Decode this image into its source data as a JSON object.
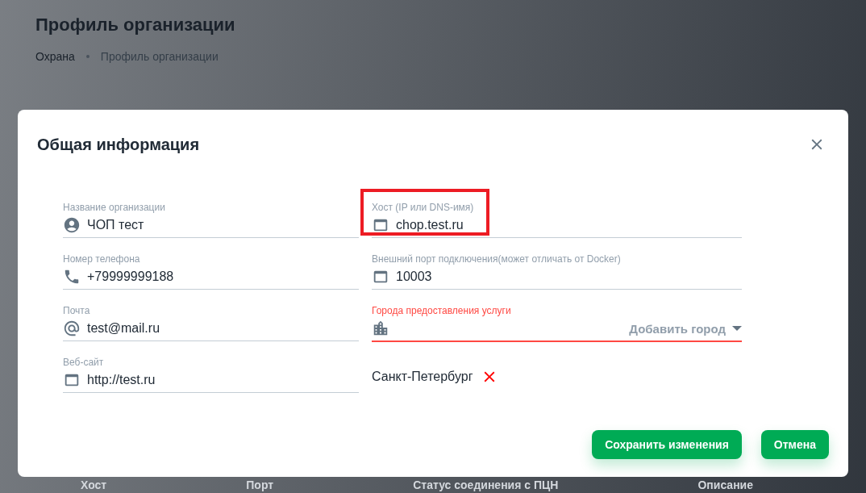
{
  "page": {
    "title": "Профиль организации",
    "breadcrumbs": [
      {
        "label": "Охрана",
        "current": false
      },
      {
        "label": "Профиль организации",
        "current": true
      }
    ],
    "table_columns": [
      "Хост",
      "Порт",
      "Статус соединения с ПЦН",
      "Описание"
    ]
  },
  "dialog": {
    "title": "Общая информация",
    "left_fields": [
      {
        "label": "Название организации",
        "value": "ЧОП тест"
      },
      {
        "label": "Номер телефона",
        "value": "+79999999188"
      },
      {
        "label": "Почта",
        "value": "test@mail.ru"
      },
      {
        "label": "Веб-сайт",
        "value": "http://test.ru"
      }
    ],
    "right_fields": [
      {
        "label": "Хост (IP или DNS-имя)",
        "value": "chop.test.ru",
        "highlighted": true
      },
      {
        "label": "Внешний порт подключения(может отличать от Docker)",
        "value": "10003",
        "highlighted": false
      }
    ],
    "cities": {
      "label": "Города предоставления услуги",
      "placeholder": "Добавить город",
      "error": true,
      "items": [
        "Санкт-Петербург"
      ]
    },
    "buttons": [
      "Сохранить изменения",
      "Отмена"
    ]
  }
}
